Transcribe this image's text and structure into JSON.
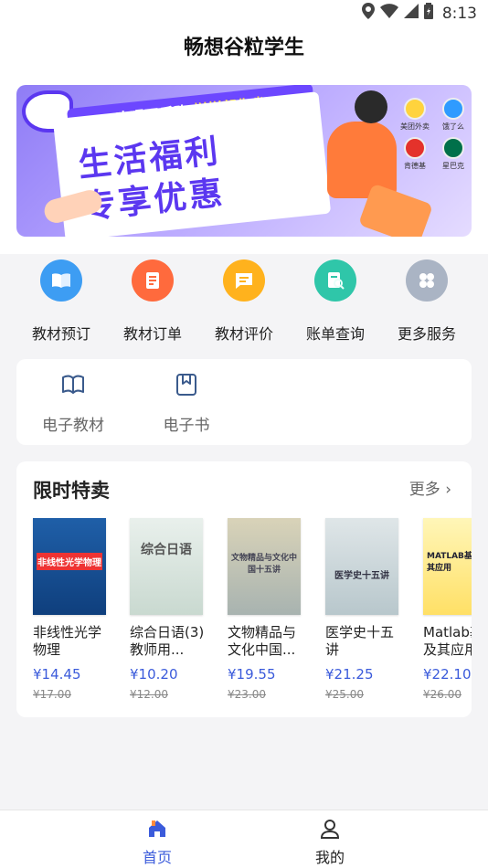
{
  "status_bar": {
    "time": "8:13",
    "icons": [
      "location-icon",
      "wifi-icon",
      "signal-icon",
      "battery-icon"
    ]
  },
  "header": {
    "title": "畅想谷粒学生"
  },
  "banner": {
    "slogan_top_a": "吃喝玩乐购",
    "slogan_top_b": "样样帮你省",
    "headline_line1": "生活福利",
    "headline_line2": "专享优惠",
    "apps": [
      "美团外卖",
      "饿了么",
      "肯德基",
      "星巴克"
    ]
  },
  "menu": {
    "items": [
      {
        "label": "教材预订",
        "icon": "book-open-icon",
        "color": "#3d9df3"
      },
      {
        "label": "教材订单",
        "icon": "order-list-icon",
        "color": "#ff6a3d"
      },
      {
        "label": "教材评价",
        "icon": "comment-icon",
        "color": "#ffb21d"
      },
      {
        "label": "账单查询",
        "icon": "bill-search-icon",
        "color": "#2fc6a9"
      },
      {
        "label": "更多服务",
        "icon": "grid-more-icon",
        "color": "#aab4c4"
      }
    ]
  },
  "ebooks": {
    "items": [
      {
        "label": "电子教材",
        "icon": "open-book-icon"
      },
      {
        "label": "电子书",
        "icon": "bookmark-book-icon"
      }
    ]
  },
  "flash_sale": {
    "title": "限时特卖",
    "more_label": "更多",
    "books": [
      {
        "title": "非线性光学物理",
        "price": "¥14.45",
        "original": "¥17.00",
        "cover_title": "非线性光学物理"
      },
      {
        "title": "综合日语(3)教师用...",
        "price": "¥10.20",
        "original": "¥12.00",
        "cover_title": "综合日语"
      },
      {
        "title": "文物精品与文化中国...",
        "price": "¥19.55",
        "original": "¥23.00",
        "cover_title": "文物精品与文化中国十五讲"
      },
      {
        "title": "医学史十五讲",
        "price": "¥21.25",
        "original": "¥25.00",
        "cover_title": "医学史十五讲"
      },
      {
        "title": "Matlab基础及其应用",
        "price": "¥22.10",
        "original": "¥26.00",
        "cover_title": "MATLAB基础及其应用"
      }
    ]
  },
  "tabbar": {
    "items": [
      {
        "label": "首页",
        "icon": "home-icon",
        "active": true
      },
      {
        "label": "我的",
        "icon": "user-icon",
        "active": false
      }
    ],
    "active_color": "#3b5bdb"
  }
}
